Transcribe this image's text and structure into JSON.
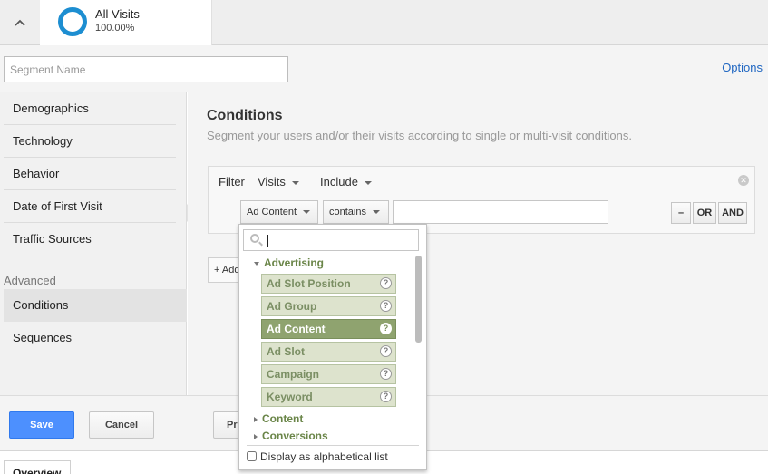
{
  "top_segment": {
    "name": "All Visits",
    "percent": "100.00%",
    "collapse_icon": "chevron-up-icon",
    "donut_color": "#1d8ed1"
  },
  "builder": {
    "segment_name_placeholder": "Segment Name",
    "options_label": "Options"
  },
  "left_nav": {
    "items": [
      "Demographics",
      "Technology",
      "Behavior",
      "Date of First Visit",
      "Traffic Sources"
    ],
    "advanced_label": "Advanced",
    "advanced_items": [
      "Conditions",
      "Sequences"
    ],
    "active_item": "Conditions"
  },
  "conditions": {
    "title": "Conditions",
    "subtitle": "Segment your users and/or their visits according to single or multi-visit conditions.",
    "filter_label": "Filter",
    "scope_value": "Visits",
    "mode_value": "Include",
    "dimension_value": "Ad Content",
    "operator_value": "contains",
    "match_value": "",
    "buttons": {
      "minus": "–",
      "or": "OR",
      "and": "AND"
    },
    "add_filter_label": "+ Add Filter"
  },
  "dropdown": {
    "search_value": "",
    "groups": [
      {
        "label": "Advertising",
        "expanded": true,
        "items": [
          "Ad Slot Position",
          "Ad Group",
          "Ad Content",
          "Ad Slot",
          "Campaign",
          "Keyword"
        ],
        "selected": "Ad Content"
      },
      {
        "label": "Content",
        "expanded": false
      },
      {
        "label": "Conversions",
        "expanded": false
      }
    ],
    "help_glyph": "?",
    "alphabetical_label": "Display as alphabetical list",
    "alphabetical_checked": false
  },
  "footer": {
    "save_label": "Save",
    "cancel_label": "Cancel",
    "preview_label": "Preview",
    "save_color": "#4d90fe"
  },
  "bottom_tab": {
    "label": "Overview"
  }
}
